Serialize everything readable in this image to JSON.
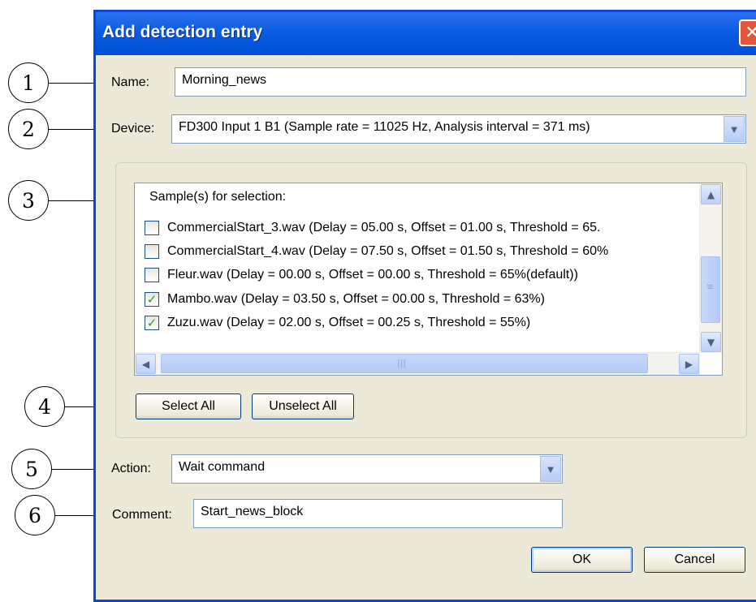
{
  "window": {
    "title": "Add detection entry",
    "close_glyph": "✕"
  },
  "callouts": [
    "1",
    "2",
    "3",
    "4",
    "5",
    "6"
  ],
  "form": {
    "name_label": "Name:",
    "name_value": "Morning_news",
    "device_label": "Device:",
    "device_value": "FD300 Input 1 B1 (Sample rate = 11025 Hz, Analysis interval = 371 ms)",
    "action_label": "Action:",
    "action_value": "Wait command",
    "comment_label": "Comment:",
    "comment_value": "Start_news_block"
  },
  "samples": {
    "header": "Sample(s) for selection:",
    "items": [
      {
        "label": "CommercialStart_3.wav (Delay = 05.00 s, Offset = 01.00 s, Threshold = 65.",
        "checked": false
      },
      {
        "label": "CommercialStart_4.wav (Delay = 07.50 s, Offset = 01.50 s, Threshold = 60%",
        "checked": false
      },
      {
        "label": "Fleur.wav (Delay = 00.00 s, Offset = 00.00 s, Threshold = 65%(default))",
        "checked": false
      },
      {
        "label": "Mambo.wav (Delay = 03.50 s, Offset = 00.00 s, Threshold = 63%)",
        "checked": true
      },
      {
        "label": "Zuzu.wav (Delay = 02.00 s, Offset = 00.25 s, Threshold = 55%)",
        "checked": true
      }
    ],
    "select_all": "Select All",
    "unselect_all": "Unselect All"
  },
  "buttons": {
    "ok": "OK",
    "cancel": "Cancel"
  },
  "colors": {
    "titlebar": "#0a5ce0",
    "accent": "#0a46d7",
    "dialog_bg": "#ece9d8",
    "check": "#21a121"
  },
  "icons": {
    "close": "close-icon",
    "dropdown": "chevron-down-icon",
    "check": "check-icon"
  }
}
